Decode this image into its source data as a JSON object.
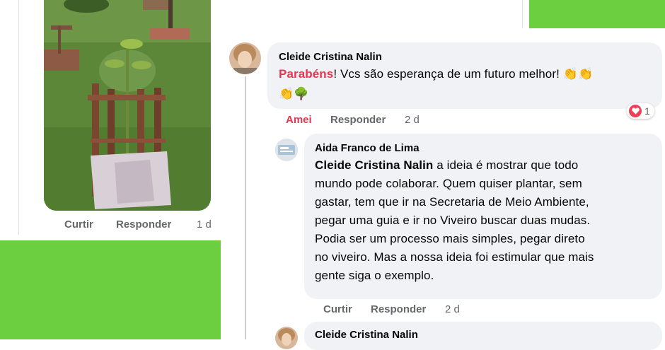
{
  "comments": [
    {
      "author": "Cleide Cristina Nalin",
      "highlight": "Parabéns",
      "text": "! Vcs são esperança de um futuro melhor!",
      "emojis_line1": "👏👏",
      "emojis_line2": "👏🌳",
      "reaction_label": "Amei",
      "reply_label": "Responder",
      "time": "2 d",
      "reaction_count": "1"
    },
    {
      "author": "Aida Franco de Lima",
      "mention": "Cleide Cristina Nalin",
      "text_lines": [
        " a ideia é mostrar que todo",
        "mundo pode colaborar. Quem quiser plantar, sem",
        "gastar, tem que ir na Secretaria de Meio Ambiente,",
        "pegar uma guia e ir no Viveiro buscar duas mudas.",
        "Podia ser um processo mais simples, pegar direto",
        "no viveiro. Mas a nossa ideia foi estimular que mais",
        "gente siga o exemplo."
      ],
      "like_label": "Curtir",
      "reply_label": "Responder",
      "time": "2 d"
    },
    {
      "author": "Cleide Cristina Nalin"
    }
  ],
  "photo_post": {
    "like_label": "Curtir",
    "reply_label": "Responder",
    "time": "1 d"
  },
  "icons": {
    "reaction": "heart-icon"
  },
  "colors": {
    "accent_green": "#6ccf3f",
    "love_red": "#e4384f",
    "meta_gray": "#65676b",
    "bubble_bg": "#f0f2f5"
  }
}
